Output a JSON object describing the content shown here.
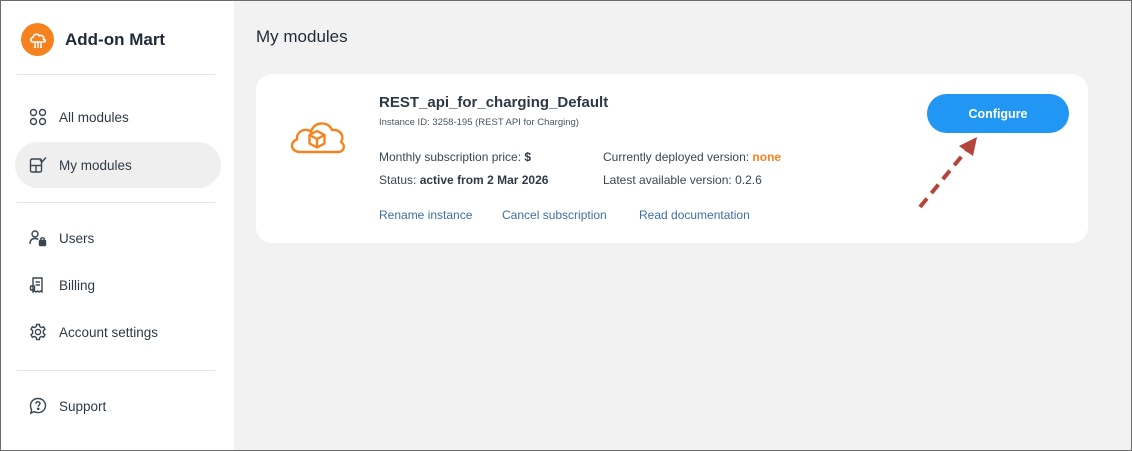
{
  "brand": {
    "name": "Add-on Mart"
  },
  "sidebar": {
    "items": [
      {
        "label": "All modules",
        "icon": "grid-circles-icon"
      },
      {
        "label": "My modules",
        "icon": "my-modules-icon",
        "active": true
      },
      {
        "label": "Users",
        "icon": "users-lock-icon"
      },
      {
        "label": "Billing",
        "icon": "billing-icon"
      },
      {
        "label": "Account settings",
        "icon": "gear-icon"
      },
      {
        "label": "Support",
        "icon": "help-icon"
      }
    ]
  },
  "main": {
    "title": "My modules",
    "module": {
      "name": "REST_api_for_charging_Default",
      "instance_id": "Instance ID: 3258-195 (REST API for Charging)",
      "price_label": "Monthly subscription price:",
      "price_value": "$",
      "status_label": "Status:",
      "status_value": "active from 2 Mar 2026",
      "deployed_label": "Currently deployed version:",
      "deployed_value": "none",
      "latest_label": "Latest available version:",
      "latest_value": "0.2.6",
      "links": {
        "rename": "Rename instance",
        "cancel": "Cancel subscription",
        "docs": "Read documentation"
      },
      "configure_label": "Configure"
    }
  },
  "colors": {
    "accent": "#f5821f",
    "primary_button": "#2196f3",
    "link": "#3e6fa3",
    "annotation_arrow": "#b5443a"
  }
}
